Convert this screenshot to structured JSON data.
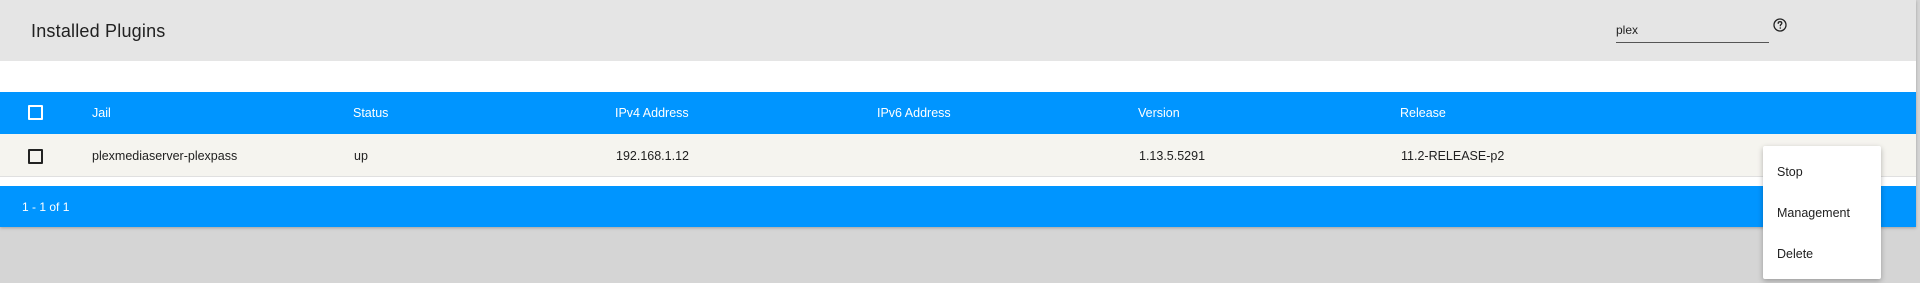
{
  "header": {
    "title": "Installed Plugins",
    "search_value": "plex",
    "help_icon": "help-circle-icon"
  },
  "table": {
    "columns": [
      "Jail",
      "Status",
      "IPv4 Address",
      "IPv6 Address",
      "Version",
      "Release"
    ],
    "rows": [
      {
        "jail": "plexmediaserver-plexpass",
        "status": "up",
        "ipv4": "192.168.1.12",
        "ipv6": "",
        "version": "1.13.5.5291",
        "release": "11.2-RELEASE-p2"
      }
    ],
    "footer_range": "1 - 1 of 1"
  },
  "context_menu": {
    "items": [
      "Stop",
      "Management",
      "Delete"
    ]
  },
  "colors": {
    "accent": "#0095ff",
    "header_bg": "#e5e5e5",
    "row_bg": "#f5f4ef",
    "page_bg": "#d5d5d5"
  }
}
